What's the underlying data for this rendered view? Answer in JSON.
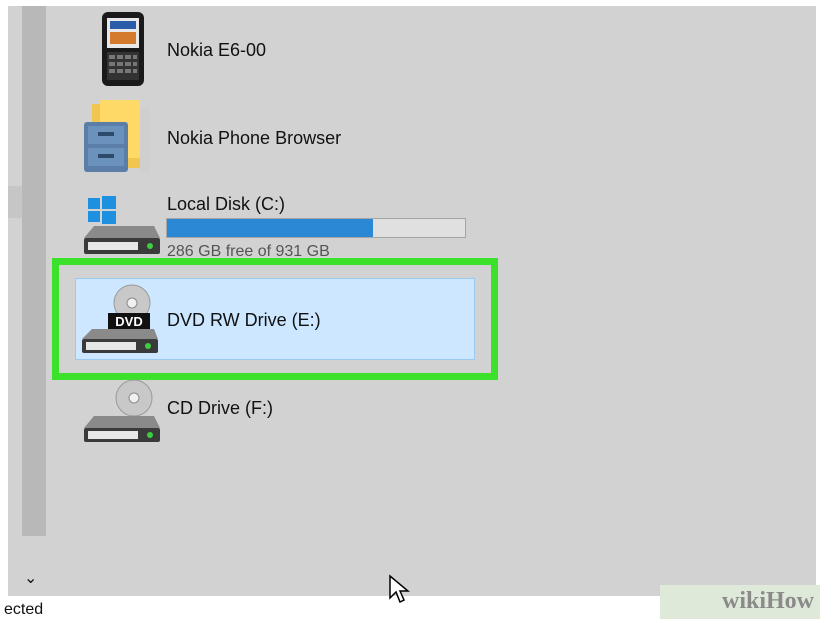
{
  "drives": [
    {
      "name": "Nokia E6-00",
      "icon": "phone-icon"
    },
    {
      "name": "Nokia Phone Browser",
      "icon": "folder-icon"
    },
    {
      "name": "Local Disk (C:)",
      "icon": "local-disk-icon",
      "free_text": "286 GB free of 931 GB",
      "used_fraction": 0.69
    },
    {
      "name": "DVD RW Drive (E:)",
      "icon": "dvd-drive-icon",
      "selected": true
    },
    {
      "name": "CD Drive (F:)",
      "icon": "cd-drive-icon"
    }
  ],
  "dvd_badge": "DVD",
  "status_text": "ected",
  "watermark": {
    "text": "wikiHow"
  },
  "colors": {
    "highlight": "#3be12a",
    "selection": "#cce7ff",
    "progress": "#2a88d5"
  }
}
